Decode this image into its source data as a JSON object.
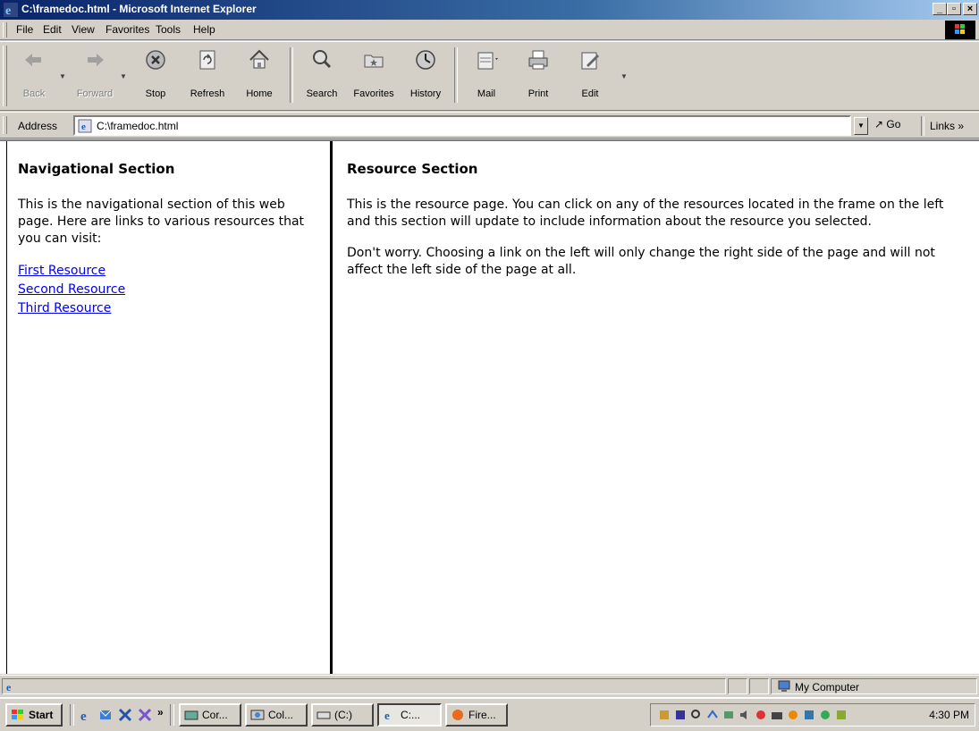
{
  "window": {
    "title": "C:\\framedoc.html - Microsoft Internet Explorer",
    "buttons": [
      "_",
      "8",
      "x"
    ]
  },
  "menu": [
    "File",
    "Edit",
    "View",
    "Favorites",
    "Tools",
    "Help"
  ],
  "toolbar": {
    "buttons": [
      {
        "label": "Back",
        "icon": "back-arrow-icon",
        "enabled": false
      },
      {
        "label": "Forward",
        "icon": "forward-arrow-icon",
        "enabled": false
      },
      {
        "label": "Stop",
        "icon": "stop-icon",
        "enabled": true
      },
      {
        "label": "Refresh",
        "icon": "refresh-icon",
        "enabled": true
      },
      {
        "label": "Home",
        "icon": "home-icon",
        "enabled": true
      },
      {
        "label": "Search",
        "icon": "search-icon",
        "enabled": true
      },
      {
        "label": "Favorites",
        "icon": "favorites-folder-icon",
        "enabled": true
      },
      {
        "label": "History",
        "icon": "history-icon",
        "enabled": true
      },
      {
        "label": "Mail",
        "icon": "mail-icon",
        "enabled": true
      },
      {
        "label": "Print",
        "icon": "printer-icon",
        "enabled": true
      },
      {
        "label": "Edit",
        "icon": "edit-icon",
        "enabled": true
      }
    ]
  },
  "address": {
    "label": "Address",
    "value": "C:\\framedoc.html",
    "go": "Go",
    "links": "Links"
  },
  "nav_frame": {
    "title": "Navigational Section",
    "text": "This is the navigational section of this web page. Here are links to various resources that you can visit:",
    "links": [
      "First Resource",
      "Second Resource",
      "Third Resource"
    ]
  },
  "resource_frame": {
    "title": "Resource Section",
    "paragraphs": [
      "This is the resource page. You can click on any of the resources located in the frame on the left and this section will update to include information about the resource you selected.",
      "Don't worry. Choosing a link on the left will only change the right side of the page and will not affect the left side of the page at all."
    ]
  },
  "status": {
    "zone": "My Computer"
  },
  "taskbar": {
    "start": "Start",
    "tasks": [
      {
        "label": "Cor...",
        "active": false
      },
      {
        "label": "Col...",
        "active": false
      },
      {
        "label": "(C:)",
        "active": false
      },
      {
        "label": "C:...",
        "active": true
      },
      {
        "label": "Fire...",
        "active": false
      }
    ],
    "clock": "4:30 PM"
  },
  "colors": {
    "titlebar": "#0a246a",
    "chrome": "#d4d0c8",
    "link": "#0000ee"
  }
}
